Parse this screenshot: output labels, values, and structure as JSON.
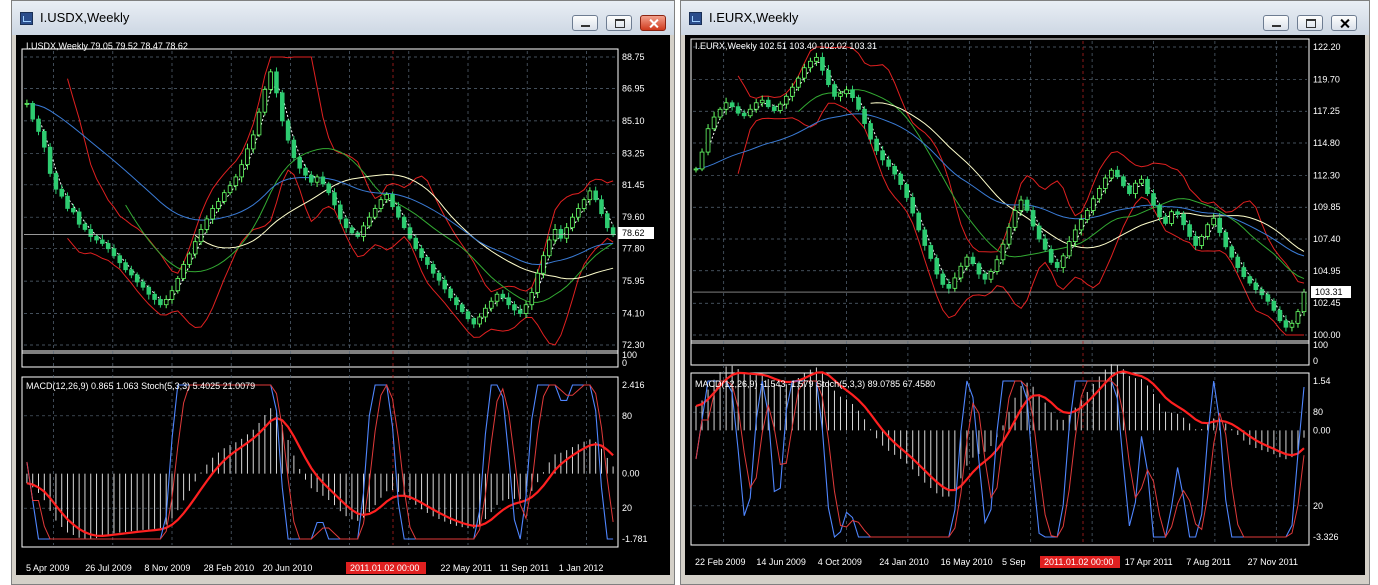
{
  "colors": {
    "bg": "#000000",
    "grid": "#5a6a7a",
    "bull": "#66ff66",
    "bear": "#2ecc71",
    "ma_red": "#e02020",
    "ma_green": "#33aa33",
    "ma_blue": "#3a7bd5",
    "ma_yellow": "#ffffcc",
    "macd_red": "#ff2020",
    "stoch_blue": "#4f86ff"
  },
  "windows": [
    {
      "title": "I.USDX,Weekly",
      "buttons": {
        "minimize": "minimize-icon",
        "maximize": "maximize-icon",
        "close": "close-icon"
      },
      "header": "I.USDX,Weekly  79.05 79.52 78.47 78.62",
      "sub_header": "MACD(12,26,9)  0.865 1.063  Stoch(5,3,3)  5.4025 21.0079",
      "price_ticks": [
        "88.75",
        "86.95",
        "85.10",
        "83.25",
        "81.45",
        "79.60",
        "77.80",
        "75.95",
        "74.10",
        "72.30"
      ],
      "current_price": "78.62",
      "osc_ticks": [
        "2.416",
        "80",
        "0.00",
        "20",
        "-1.781"
      ],
      "sep_ticks": [
        "100",
        "0"
      ],
      "date_ticks": [
        "5 Apr 2009",
        "26 Jul 2009",
        "8 Nov 2009",
        "28 Feb 2010",
        "20 Jun 2010",
        "",
        "2011",
        "22 May 2011",
        "11 Sep 2011",
        "1 Jan 2012"
      ],
      "cursor_date": "2011.01.02 00:00",
      "chart_data": {
        "type": "candlestick",
        "ylim": [
          72.3,
          88.75
        ],
        "close": [
          86.1,
          85.2,
          84.5,
          83.6,
          82.1,
          81.2,
          80.8,
          80.1,
          79.9,
          79.2,
          78.9,
          78.5,
          78.3,
          78.1,
          77.8,
          77.4,
          77.0,
          76.6,
          76.3,
          75.9,
          75.6,
          75.2,
          74.9,
          74.6,
          74.9,
          75.4,
          76.1,
          76.9,
          77.5,
          78.2,
          78.9,
          79.5,
          80.1,
          80.5,
          81.0,
          81.4,
          81.9,
          82.6,
          83.5,
          84.3,
          85.6,
          86.9,
          87.9,
          86.7,
          85.1,
          84.0,
          83.0,
          82.4,
          82.0,
          81.6,
          81.9,
          81.5,
          81.0,
          80.3,
          79.5,
          79.0,
          78.7,
          78.5,
          79.1,
          79.6,
          80.1,
          80.6,
          80.9,
          80.2,
          79.6,
          79.0,
          78.4,
          77.8,
          77.3,
          76.9,
          76.4,
          76.0,
          75.5,
          75.0,
          74.6,
          74.2,
          73.8,
          73.5,
          73.9,
          74.4,
          74.8,
          75.2,
          75.0,
          74.6,
          74.3,
          74.1,
          74.6,
          75.3,
          76.4,
          77.4,
          78.3,
          78.9,
          78.4,
          79.0,
          79.6,
          80.1,
          80.6,
          81.1,
          80.6,
          79.8,
          79.0,
          78.6
        ]
      },
      "macd_range": [
        -1.781,
        2.416
      ]
    },
    {
      "title": "I.EURX,Weekly",
      "buttons": {
        "minimize": "minimize-icon",
        "maximize": "maximize-icon",
        "close": "close-icon"
      },
      "header": "I.EURX,Weekly  102.51 103.40 102.02 103.31",
      "sub_header": "MACD(12,26,9)  -1.543 -1.579  Stoch(5,3,3)  89.0785 67.4580",
      "price_ticks": [
        "122.20",
        "119.70",
        "117.25",
        "114.80",
        "112.30",
        "109.85",
        "107.40",
        "104.95",
        "102.45",
        "100.00"
      ],
      "current_price": "103.31",
      "osc_ticks": [
        "1.54",
        "80",
        "0.00",
        "20",
        "-3.326"
      ],
      "sep_ticks": [
        "100",
        "0"
      ],
      "date_ticks": [
        "22 Feb 2009",
        "14 Jun 2009",
        "4 Oct 2009",
        "24 Jan 2010",
        "16 May 2010",
        "5 Sep",
        "0",
        "17 Apr 2011",
        "7 Aug 2011",
        "27 Nov 2011"
      ],
      "cursor_date": "2011.01.02 00:00",
      "chart_data": {
        "type": "candlestick",
        "ylim": [
          100.0,
          122.2
        ],
        "close": [
          112.8,
          114.1,
          115.9,
          116.8,
          117.4,
          117.9,
          117.6,
          117.1,
          116.9,
          117.4,
          117.9,
          118.1,
          117.6,
          117.3,
          117.8,
          118.4,
          119.1,
          119.8,
          120.6,
          121.1,
          121.4,
          120.4,
          119.3,
          118.4,
          118.6,
          118.9,
          118.3,
          117.4,
          116.3,
          115.1,
          114.2,
          113.5,
          113.0,
          112.4,
          111.6,
          110.6,
          109.4,
          108.1,
          106.9,
          105.9,
          104.7,
          103.9,
          103.6,
          104.4,
          105.3,
          106.0,
          105.5,
          104.7,
          104.3,
          104.9,
          105.8,
          107.0,
          108.3,
          109.6,
          110.4,
          109.6,
          108.4,
          107.4,
          106.6,
          105.6,
          105.2,
          106.1,
          107.2,
          108.1,
          108.9,
          109.6,
          110.5,
          111.3,
          112.1,
          112.7,
          112.2,
          111.5,
          110.9,
          111.7,
          112.0,
          110.9,
          110.0,
          109.1,
          108.6,
          109.5,
          109.3,
          108.5,
          107.6,
          106.9,
          107.6,
          108.5,
          109.0,
          107.9,
          106.8,
          106.0,
          105.2,
          104.5,
          104.0,
          103.5,
          103.1,
          102.6,
          101.9,
          101.1,
          100.6,
          100.9,
          101.8,
          103.3
        ]
      },
      "macd_range": [
        -3.326,
        1.54
      ]
    }
  ]
}
